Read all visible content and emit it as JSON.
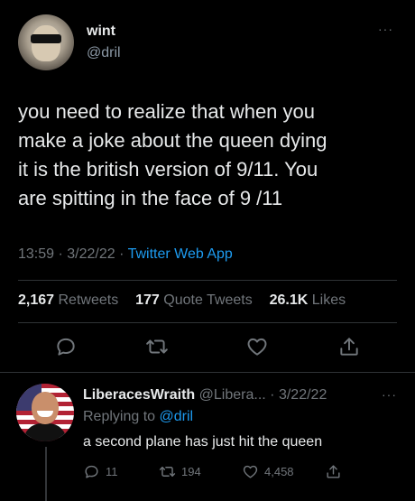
{
  "tweet": {
    "display_name": "wint",
    "handle": "@dril",
    "more": "···",
    "lines": [
      "you need to realize that when you",
      "make a joke about the queen dying",
      "it is the british version of 9/11. You",
      "are spitting in the face of 9 /11"
    ],
    "time": "13:59",
    "date": "3/22/22",
    "source": "Twitter Web App",
    "retweets": "2,167",
    "retweets_label": "Retweets",
    "quotes": "177",
    "quotes_label": "Quote Tweets",
    "likes": "26.1K",
    "likes_label": "Likes"
  },
  "reply": {
    "display_name": "LiberacesWraith",
    "handle": "@Libera...",
    "date": "3/22/22",
    "more": "···",
    "replying_prefix": "Replying to",
    "replying_to": "@dril",
    "text": "a second plane has just hit the queen",
    "reply_count": "11",
    "retweet_count": "194",
    "like_count": "4,458"
  },
  "colors": {
    "background": "#000000",
    "text": "#e7e9ea",
    "muted": "#71767b",
    "accent": "#1d9bf0",
    "divider": "#2f3336"
  },
  "icons": [
    "reply-icon",
    "retweet-icon",
    "like-icon",
    "share-icon"
  ]
}
